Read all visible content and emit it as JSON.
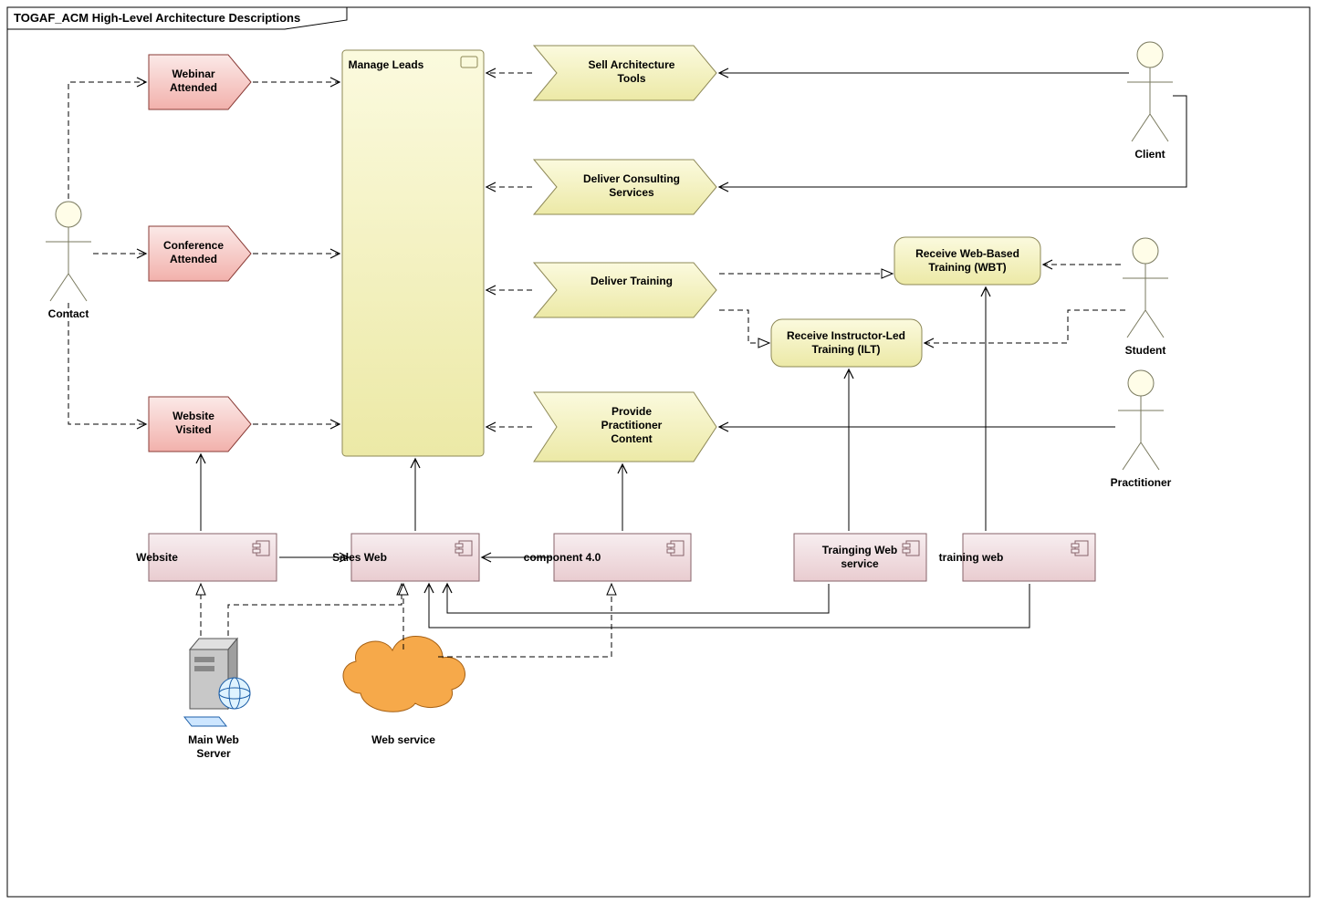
{
  "diagram": {
    "title": "TOGAF_ACM High-Level Architecture Descriptions",
    "actors": {
      "contact": "Contact",
      "client": "Client",
      "student": "Student",
      "practitioner": "Practitioner"
    },
    "events": {
      "webinar": "Webinar Attended",
      "conference": "Conference Attended",
      "website": "Website Visited"
    },
    "process": {
      "manage_leads": "Manage Leads"
    },
    "services": {
      "sell_tools": "Sell Architecture Tools",
      "deliver_consulting": "Deliver Consulting Services",
      "deliver_training": "Deliver Training",
      "provide_content": "Provide Practitioner Content"
    },
    "activities": {
      "receive_wbt": "Receive Web-Based Training (WBT)",
      "receive_ilt": "Receive Instructor-Led Training (ILT)"
    },
    "components": {
      "website": "Website",
      "sales_web": "Sales Web",
      "component40": "component 4.0",
      "training_ws": "Trainging Web service",
      "training_web": "training web"
    },
    "nodes": {
      "main_web_server": "Main Web Server",
      "web_service": "Web service"
    }
  }
}
